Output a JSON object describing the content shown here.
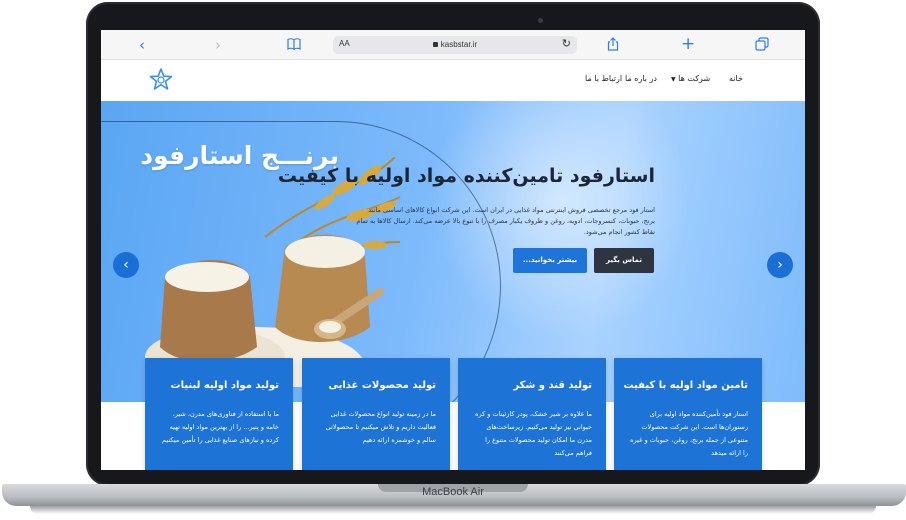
{
  "device": {
    "model_label": "MacBook Air"
  },
  "browser": {
    "back_icon": "‹",
    "forward_icon": "›",
    "aa_label": "AA",
    "url": "kasbstar.ir",
    "reload_icon": "↻",
    "share_icon": "⇧",
    "add_icon": "+",
    "tabs_icon": "⧉",
    "bookmarks_icon": "📖"
  },
  "nav": {
    "items": [
      "خانه",
      "شرکت ها",
      "در باره ما",
      "ارتباط با ما"
    ]
  },
  "hero": {
    "heading": "استارفود تامین‌کننده مواد اولیه با کیفیت",
    "description": "استار فود مرجع تخصصی فروش اینترنتی مواد غذایی در ایران است. این شرکت انواع کالاهای اساسی مانند برنج، حبوبات، کنسروجات، ادویه، روغن و ظروف یکبار مصرف را با تنوع بالا عرضه می‌کند. ارسال کالاها به تمام نقاط کشور انجام می‌شود.",
    "contact_button": "تماس بگیر",
    "more_button": "بیشتر بخوانید...",
    "rice_title": "برنـــج استارفود",
    "prev_arrow": "‹",
    "next_arrow": "›"
  },
  "cards": [
    {
      "title": "تامین مواد اولیه با کیفیت",
      "text": "استار فود تأمین‌کننده مواد اولیه برای رستوران‌ها است. این شرکت محصولات متنوعی از جمله برنج، روغن، حبوبات و غیره را ارائه میدهد"
    },
    {
      "title": "تولید قند و شکر",
      "text": "ما علاوه بر شیر خشک، پودر کازئینات و کره حیوانی نیز تولید می‌کنیم. زیرساخت‌های مدرن ما امکان تولید محصولات متنوع را فراهم می‌کنند"
    },
    {
      "title": "تولید محصولات غذایی",
      "text": "ما در زمینه تولید انواع محصولات غذایی فعالیت داریم و تلاش میکنیم تا محصولاتی سالم و خوشمزه ارائه دهیم"
    },
    {
      "title": "تولید مواد اولیه لبنیات",
      "text": "ما با استفاده از فناوری‌های مدرن، شیر، خامه و پنیر... را از بهترین مواد اولیه تهیه کرده و نیازهای صنایع غذایی را تأمین میکنیم"
    }
  ],
  "colors": {
    "primary_blue": "#1e73d6",
    "hero_blue": "#7dbafb",
    "dark_button": "#2e3440"
  }
}
